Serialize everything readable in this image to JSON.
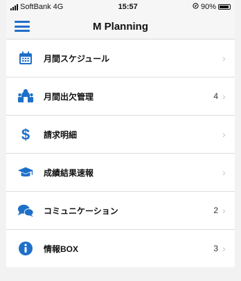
{
  "status": {
    "carrier": "SoftBank",
    "network": "4G",
    "time": "15:57",
    "battery_text": "90%",
    "battery_level": 0.9,
    "location_icon": "location-arrow-icon"
  },
  "header": {
    "menu_icon": "hamburger-menu-icon",
    "title": "M Planning"
  },
  "colors": {
    "accent": "#1e6fc8",
    "background": "#f2f2f2"
  },
  "menu": {
    "items": [
      {
        "label": "月間スケジュール",
        "count": "",
        "icon": "calendar-icon"
      },
      {
        "label": "月間出欠管理",
        "count": "4",
        "icon": "family-icon"
      },
      {
        "label": "請求明細",
        "count": "",
        "icon": "dollar-icon"
      },
      {
        "label": "成績結果速報",
        "count": "",
        "icon": "graduation-cap-icon"
      },
      {
        "label": "コミュニケーション",
        "count": "2",
        "icon": "chat-bubbles-icon"
      },
      {
        "label": "情報BOX",
        "count": "3",
        "icon": "info-icon"
      }
    ]
  }
}
